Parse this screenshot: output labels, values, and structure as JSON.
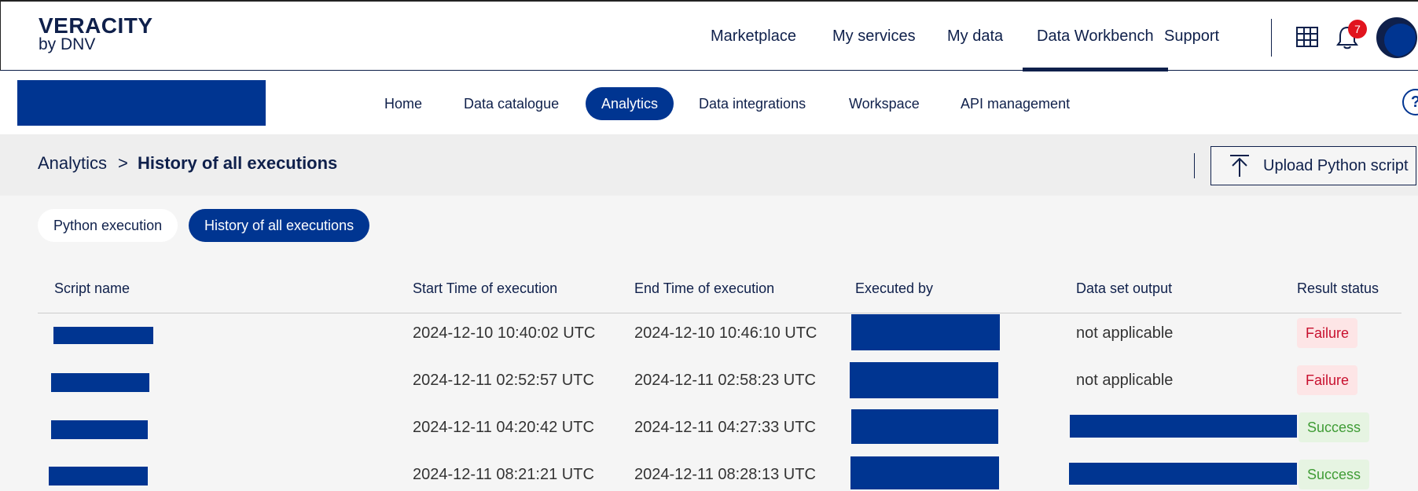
{
  "brand": {
    "name": "VERACITY",
    "sub": "by DNV"
  },
  "top_nav": [
    "Marketplace",
    "My services",
    "My data",
    "Data Workbench",
    "Support"
  ],
  "notifications": {
    "count": "7"
  },
  "sub_nav": [
    "Home",
    "Data catalogue",
    "Analytics",
    "Data integrations",
    "Workspace",
    "API management"
  ],
  "help": {
    "label": "?"
  },
  "breadcrumb": {
    "root": "Analytics",
    "separator": ">",
    "current": "History of all executions"
  },
  "upload": {
    "label": "Upload Python script"
  },
  "tabs": [
    "Python execution",
    "History of all executions"
  ],
  "table": {
    "headers": [
      "Script name",
      "Start Time of execution",
      "End Time of execution",
      "Executed by",
      "Data set output",
      "Result status"
    ],
    "rows": [
      {
        "start": "2024-12-10 10:40:02 UTC",
        "end": "2024-12-10 10:46:10 UTC",
        "output": "not applicable",
        "status": "Failure"
      },
      {
        "start": "2024-12-11 02:52:57 UTC",
        "end": "2024-12-11 02:58:23 UTC",
        "output": "not applicable",
        "status": "Failure"
      },
      {
        "start": "2024-12-11 04:20:42 UTC",
        "end": "2024-12-11 04:27:33 UTC",
        "output": "",
        "status": "Success"
      },
      {
        "start": "2024-12-11 08:21:21 UTC",
        "end": "2024-12-11 08:28:13 UTC",
        "output": "",
        "status": "Success"
      }
    ]
  },
  "colors": {
    "navy": "#0f204b",
    "brand_blue": "#003591",
    "failure": "#c8102e",
    "success": "#3f9c35",
    "badge": "#e1141e"
  }
}
